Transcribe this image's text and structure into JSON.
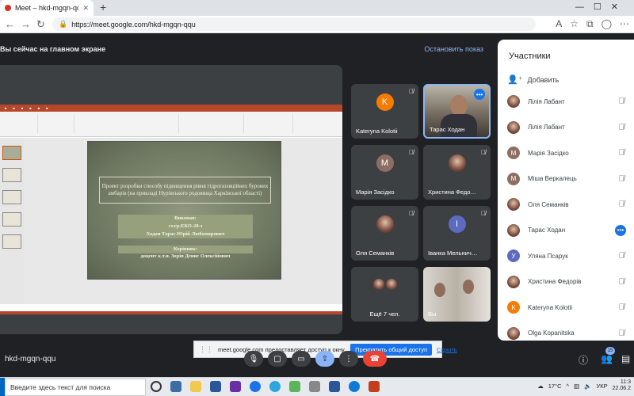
{
  "browser": {
    "tab_title": "Meet – hkd-mgqn-qqu",
    "tab_close": "✕",
    "new_tab": "+",
    "url": "https://meet.google.com/hkd-mgqn-qqu",
    "window_controls": "—☐✕"
  },
  "banner": {
    "message": "Вы сейчас на главном экране",
    "stop_label": "Остановить показ"
  },
  "slide": {
    "title": "Проект розробки способу підвищення рівня гідроізоляційних бурових амбарів (на прикладі Нурівського родовища Харківської області)",
    "performed_label": "Виконав:",
    "group": "ст.гр.ЕКО-20-з",
    "author": "Ходан Тарас-Юрій Любомирович",
    "supervisor_label": "Керівник:",
    "supervisor": "доцент к.т.н. Зорін Денис Олексійович",
    "faint_line": "роботи: гідроізоляції"
  },
  "tiles": [
    {
      "name": "Kateryna Kolotii",
      "initial": "K",
      "color": "#f57c00"
    },
    {
      "name": "Тарас Ходан",
      "initial": "",
      "color": ""
    },
    {
      "name": "Марія Засідко",
      "initial": "М",
      "color": "#8d6e63"
    },
    {
      "name": "Христина Федо…",
      "initial": "",
      "color": ""
    },
    {
      "name": "Оля Семанків",
      "initial": "",
      "color": ""
    },
    {
      "name": "Іванка Мельнич…",
      "initial": "І",
      "color": "#5c6bc0"
    },
    {
      "name": "Ещё 7 чел.",
      "initial": "",
      "color": ""
    },
    {
      "name": "Вы",
      "initial": "",
      "color": ""
    }
  ],
  "panel": {
    "title": "Участники",
    "add_label": "Добавить",
    "participants": [
      {
        "name": "Лілія Лабант",
        "initial": "",
        "color": "#7a4b3d"
      },
      {
        "name": "Лілія Лабант",
        "initial": "",
        "color": "#7a4b3d"
      },
      {
        "name": "Марія Засідко",
        "initial": "М",
        "color": "#8d6e63"
      },
      {
        "name": "Міша Веркалець",
        "initial": "М",
        "color": "#8d6e63"
      },
      {
        "name": "Оля Семанків",
        "initial": "",
        "color": "#a0665a"
      },
      {
        "name": "Тарас Ходан",
        "initial": "",
        "color": "#6d5344"
      },
      {
        "name": "Уляна Псарук",
        "initial": "У",
        "color": "#5c6bc0"
      },
      {
        "name": "Христина Федорів",
        "initial": "",
        "color": "#8c6f66"
      },
      {
        "name": "Kateryna Kolotii",
        "initial": "K",
        "color": "#f57c00"
      },
      {
        "name": "Olga Kopanitska",
        "initial": "",
        "color": "#9c7a5b"
      }
    ]
  },
  "notice": {
    "text": "meet.google.com предоставляет доступ к окну.",
    "share_label": "Прекратить общий доступ",
    "hide_label": "Скрыть"
  },
  "meeting_code": "hkd-mgqn-qqu",
  "participant_count": "15",
  "taskbar": {
    "search_placeholder": "Введите здесь текст для поиска",
    "temperature": "17°C",
    "lang": "УКР",
    "time": "11:3",
    "date": "22.06.2"
  },
  "colors": {
    "meet_bg": "#202124",
    "tile_bg": "#3c4043",
    "accent_blue": "#1a73e8",
    "end_call_red": "#ea4335"
  }
}
